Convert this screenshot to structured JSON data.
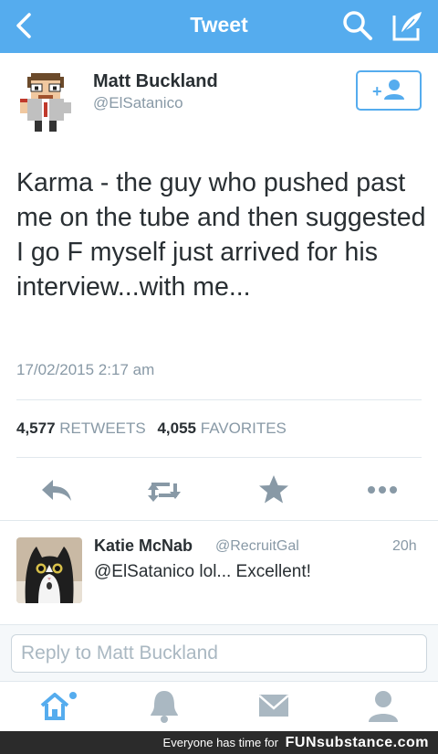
{
  "nav": {
    "title": "Tweet"
  },
  "tweet": {
    "author_name": "Matt Buckland",
    "author_handle": "@ElSatanico",
    "text": "Karma - the guy who pushed past me on the tube and then suggested I go F myself just arrived for his interview...with me...",
    "timestamp": "17/02/2015 2:17 am",
    "retweets_count": "4,577",
    "retweets_label": "RETWEETS",
    "favorites_count": "4,055",
    "favorites_label": "FAVORITES"
  },
  "reply": {
    "name": "Katie McNab",
    "handle": "@RecruitGal",
    "time": "20h",
    "text": "@ElSatanico lol... Excellent!"
  },
  "compose": {
    "placeholder": "Reply to Matt Buckland"
  },
  "watermark": {
    "prefix": "Everyone has time for",
    "brand": "FUNsubstance.com"
  },
  "icons": {
    "back": "chevron-left-icon",
    "search": "search-icon",
    "compose": "compose-icon",
    "follow": "add-user-icon",
    "reply": "reply-icon",
    "retweet": "retweet-icon",
    "favorite": "star-icon",
    "more": "more-icon",
    "home": "home-icon",
    "notifications": "bell-icon",
    "messages": "envelope-icon",
    "me": "person-icon"
  },
  "colors": {
    "brand": "#55acee",
    "text": "#292f33",
    "secondary": "#8899a6",
    "icon_grey": "#8899a6"
  }
}
